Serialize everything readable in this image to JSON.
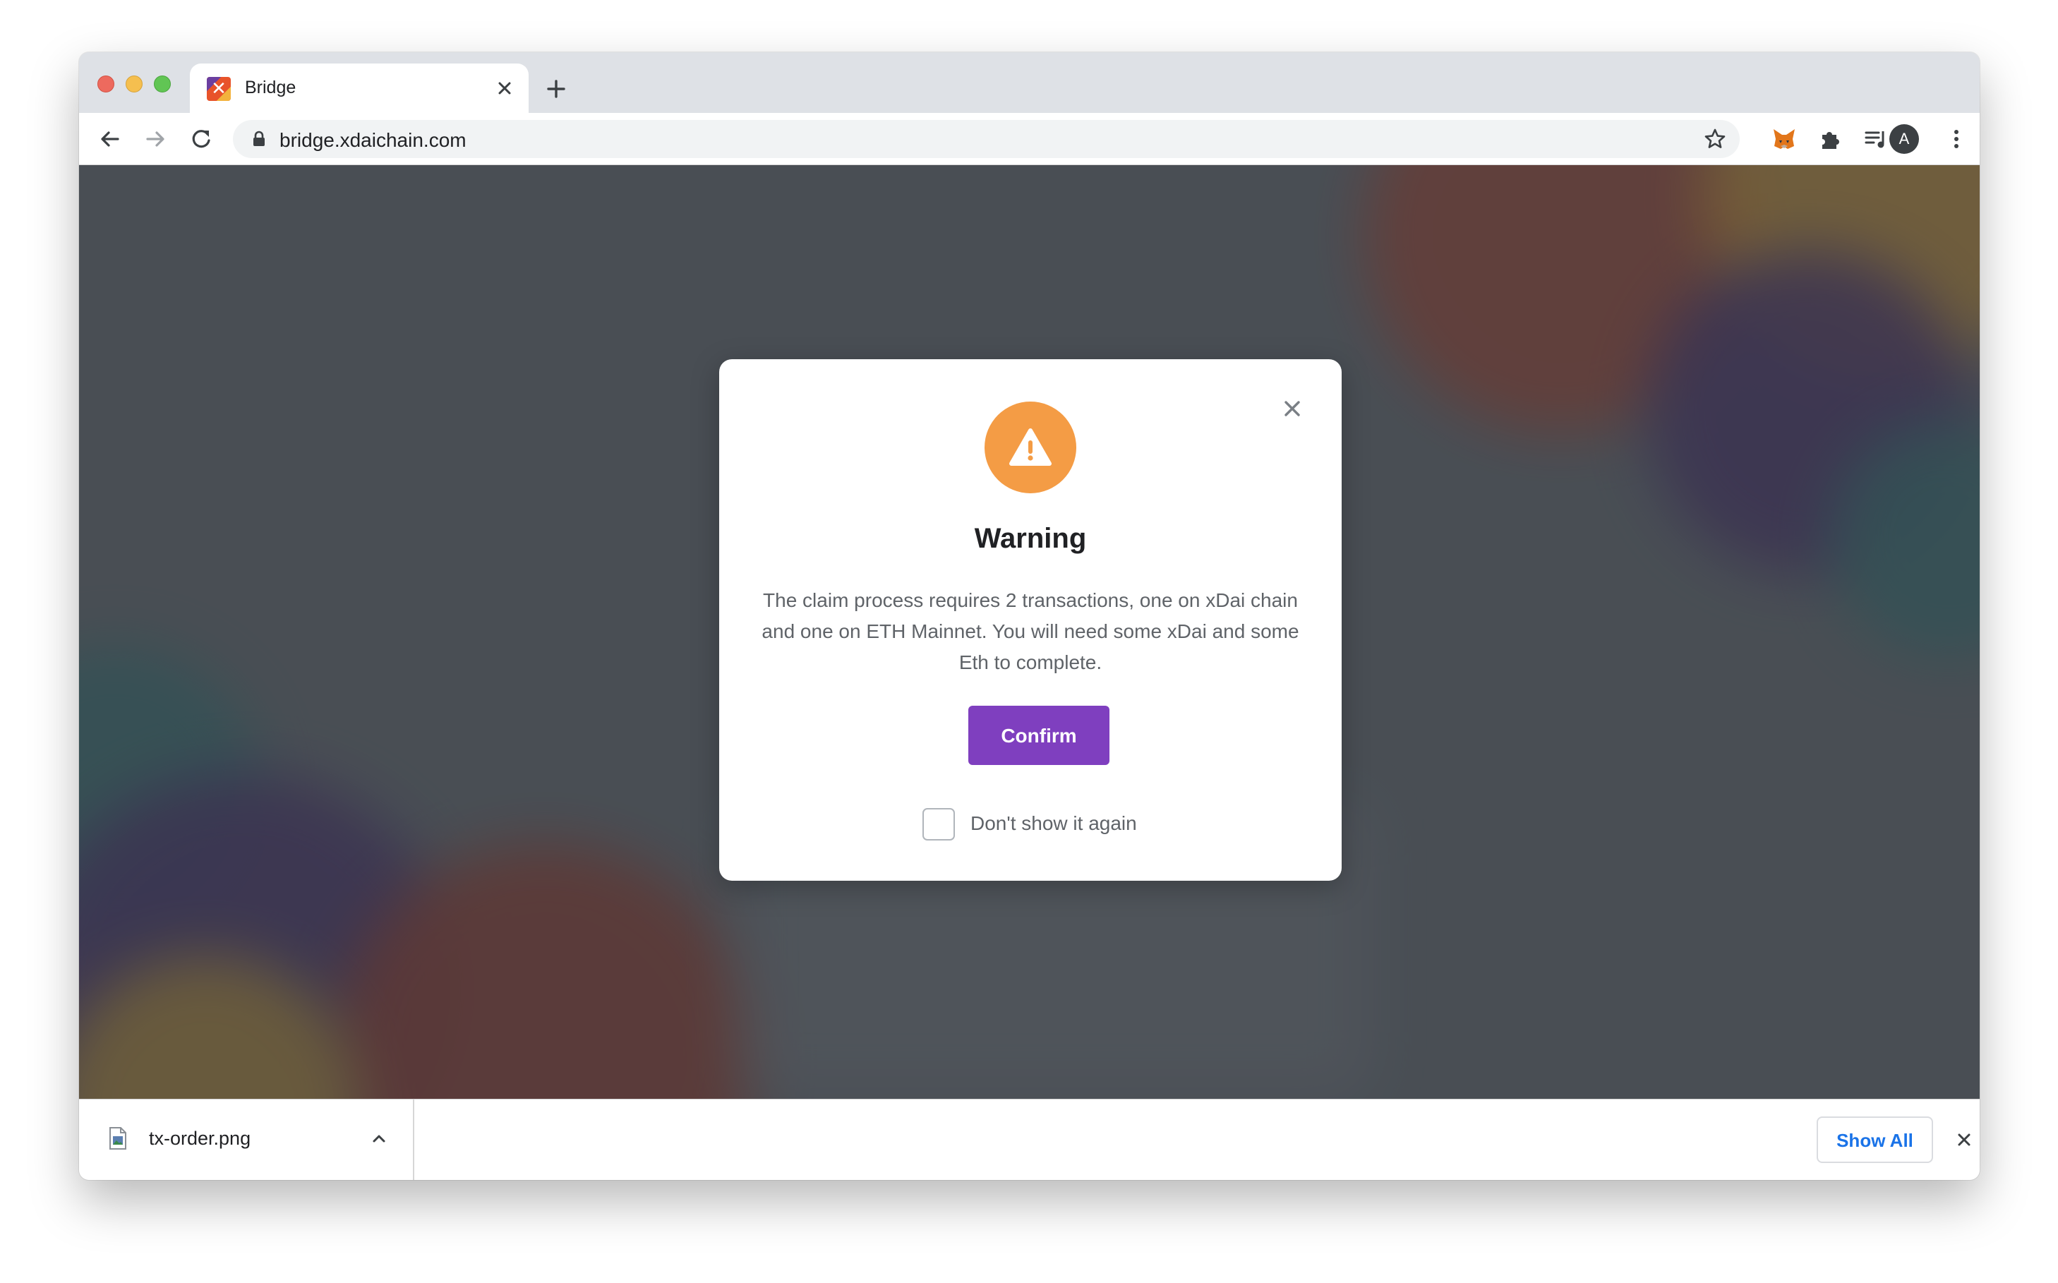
{
  "browser": {
    "tab": {
      "title": "Bridge"
    },
    "address_bar": {
      "url": "bridge.xdaichain.com"
    },
    "profile_initial": "A"
  },
  "modal": {
    "icon": "warning-icon",
    "title": "Warning",
    "message": "The claim process requires 2 transactions, one on xDai chain and one on ETH Mainnet. You will need some xDai and some Eth to complete.",
    "confirm_label": "Confirm",
    "dont_show_label": "Don't show it again",
    "dont_show_checked": false
  },
  "download_bar": {
    "file_name": "tx-order.png",
    "show_all_label": "Show All"
  },
  "colors": {
    "accent_purple": "#7f3fbf",
    "warning_orange": "#f49c45",
    "link_blue": "#1a73e8"
  }
}
